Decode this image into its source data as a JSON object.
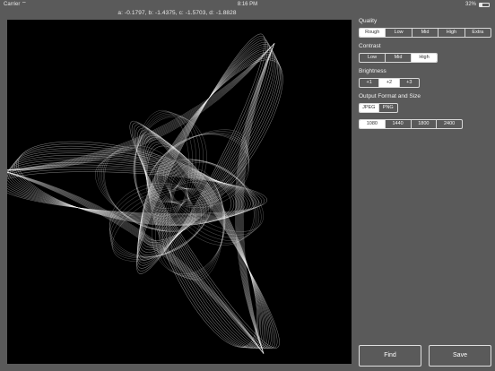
{
  "status_bar": {
    "carrier": "Carrier",
    "time": "8:16 PM",
    "battery_percent": "32%",
    "battery_level": 0.32
  },
  "parameters_text": "a: -0.1797, b: -1.4375, c: -1.5703, d: -1.8828",
  "settings": {
    "quality": {
      "label": "Quality",
      "options": [
        "Rough",
        "Low",
        "Mid",
        "High",
        "Extra"
      ],
      "selected": 0
    },
    "contrast": {
      "label": "Contrast",
      "options": [
        "Low",
        "Mid",
        "High"
      ],
      "selected": 2
    },
    "brightness": {
      "label": "Brightness",
      "options": [
        "+1",
        "+2",
        "+3"
      ],
      "selected": 1
    },
    "output": {
      "label": "Output Format and Size",
      "formats": [
        "JPEG",
        "PNG"
      ],
      "format_selected": 0,
      "sizes": [
        "1080",
        "1440",
        "1800",
        "2400"
      ],
      "size_selected": 0
    }
  },
  "buttons": {
    "find": "Find",
    "save": "Save"
  },
  "colors": {
    "background": "#5a5a5a",
    "canvas": "#000000",
    "selected": "#ffffff"
  }
}
